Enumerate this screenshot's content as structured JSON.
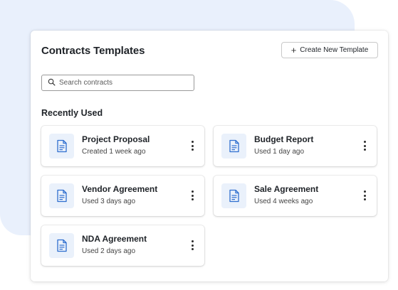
{
  "header": {
    "title": "Contracts Templates",
    "create_button_label": "Create New Template",
    "create_button_icon": "plus-icon"
  },
  "search": {
    "placeholder": "Search contracts",
    "value": "",
    "icon": "search-icon"
  },
  "section": {
    "title": "Recently Used"
  },
  "templates": [
    {
      "name": "Project Proposal",
      "meta": "Created 1 week ago",
      "icon": "document-icon"
    },
    {
      "name": "Budget Report",
      "meta": "Used 1 day ago",
      "icon": "document-icon"
    },
    {
      "name": "Vendor Agreement",
      "meta": "Used 3 days ago",
      "icon": "document-icon"
    },
    {
      "name": "Sale Agreement",
      "meta": "Used 4 weeks ago",
      "icon": "document-icon"
    },
    {
      "name": "NDA Agreement",
      "meta": "Used 2 days ago",
      "icon": "document-icon"
    }
  ],
  "colors": {
    "backdrop": "#e9f0fc",
    "icon_tile": "#eaf1fb",
    "icon_accent": "#2f6fcf"
  }
}
